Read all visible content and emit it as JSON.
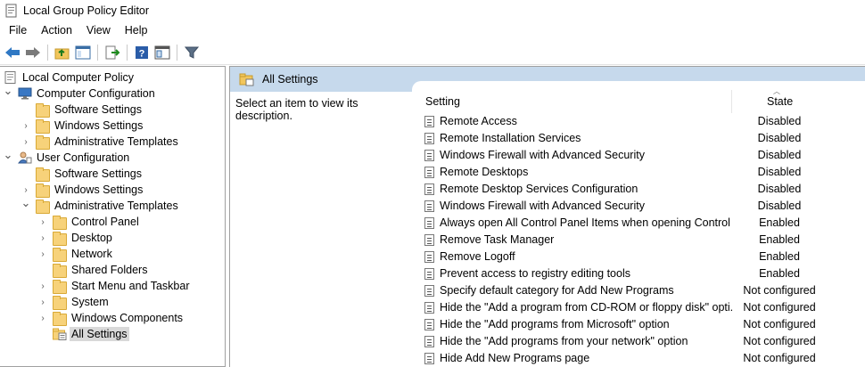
{
  "window": {
    "title": "Local Group Policy Editor"
  },
  "menu": [
    "File",
    "Action",
    "View",
    "Help"
  ],
  "toolbar": {
    "buttons": [
      "back-arrow-icon",
      "forward-arrow-icon",
      "up-folder-icon",
      "show-hide-tree-icon",
      "export-list-icon",
      "help-icon",
      "properties-icon",
      "filter-icon"
    ]
  },
  "tree": [
    {
      "label": "Local Computer Policy",
      "level": 0,
      "chevron": "none",
      "icon": "policy"
    },
    {
      "label": "Computer Configuration",
      "level": 0,
      "chevron": "down",
      "icon": "computer"
    },
    {
      "label": "Software Settings",
      "level": 1,
      "chevron": "none",
      "icon": "folder"
    },
    {
      "label": "Windows Settings",
      "level": 1,
      "chevron": "right",
      "icon": "folder"
    },
    {
      "label": "Administrative Templates",
      "level": 1,
      "chevron": "right",
      "icon": "folder"
    },
    {
      "label": "User Configuration",
      "level": 0,
      "chevron": "down",
      "icon": "user"
    },
    {
      "label": "Software Settings",
      "level": 1,
      "chevron": "none",
      "icon": "folder"
    },
    {
      "label": "Windows Settings",
      "level": 1,
      "chevron": "right",
      "icon": "folder"
    },
    {
      "label": "Administrative Templates",
      "level": 1,
      "chevron": "down",
      "icon": "folder"
    },
    {
      "label": "Control Panel",
      "level": 2,
      "chevron": "right",
      "icon": "folder"
    },
    {
      "label": "Desktop",
      "level": 2,
      "chevron": "right",
      "icon": "folder"
    },
    {
      "label": "Network",
      "level": 2,
      "chevron": "right",
      "icon": "folder"
    },
    {
      "label": "Shared Folders",
      "level": 2,
      "chevron": "none",
      "icon": "folder"
    },
    {
      "label": "Start Menu and Taskbar",
      "level": 2,
      "chevron": "right",
      "icon": "folder"
    },
    {
      "label": "System",
      "level": 2,
      "chevron": "right",
      "icon": "folder"
    },
    {
      "label": "Windows Components",
      "level": 2,
      "chevron": "right",
      "icon": "folder"
    },
    {
      "label": "All Settings",
      "level": 2,
      "chevron": "none",
      "icon": "settings-folder",
      "selected": true
    }
  ],
  "right": {
    "header": "All Settings",
    "description": "Select an item to view its description.",
    "columns": {
      "setting": "Setting",
      "state": "State"
    },
    "rows": [
      {
        "name": "Remote Access",
        "state": "Disabled"
      },
      {
        "name": "Remote Installation Services",
        "state": "Disabled"
      },
      {
        "name": "Windows Firewall with Advanced Security",
        "state": "Disabled"
      },
      {
        "name": "Remote Desktops",
        "state": "Disabled"
      },
      {
        "name": "Remote Desktop Services Configuration",
        "state": "Disabled"
      },
      {
        "name": "Windows Firewall with Advanced Security",
        "state": "Disabled"
      },
      {
        "name": "Always open All Control Panel Items when opening Control ...",
        "state": "Enabled"
      },
      {
        "name": "Remove Task Manager",
        "state": "Enabled"
      },
      {
        "name": "Remove Logoff",
        "state": "Enabled"
      },
      {
        "name": "Prevent access to registry editing tools",
        "state": "Enabled"
      },
      {
        "name": "Specify default category for Add New Programs",
        "state": "Not configured"
      },
      {
        "name": "Hide the \"Add a program from CD-ROM or floppy disk\" opti...",
        "state": "Not configured"
      },
      {
        "name": "Hide the \"Add programs from Microsoft\" option",
        "state": "Not configured"
      },
      {
        "name": "Hide the \"Add programs from your network\" option",
        "state": "Not configured"
      },
      {
        "name": "Hide Add New Programs page",
        "state": "Not configured"
      }
    ]
  },
  "colors": {
    "header_band": "#c6d9ec",
    "selected": "#d9d9d9",
    "folder": "#f7d27a"
  }
}
